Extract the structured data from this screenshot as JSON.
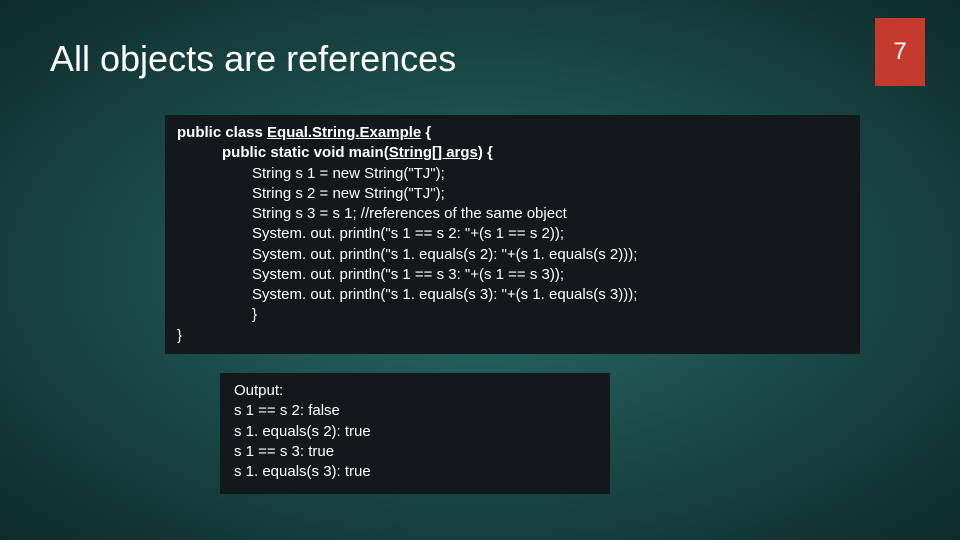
{
  "title": "All objects are references",
  "page_number": "7",
  "code": {
    "line1_pre": "public class ",
    "line1_name": "Equal.String.Example",
    "line1_post": " {",
    "line2_pre": "public static void main(",
    "line2_param": "String[] args",
    "line2_post": ") {",
    "line3": "String s 1 = new String(\"TJ\");",
    "line4": "String s 2 = new String(\"TJ\");",
    "line5": "String s 3 = s 1; //references of the same object",
    "line6": "System. out. println(\"s 1 == s 2: \"+(s 1 == s 2));",
    "line7": "System. out. println(\"s 1. equals(s 2): \"+(s 1. equals(s 2)));",
    "line8": "System. out. println(\"s 1 == s 3: \"+(s 1 == s 3));",
    "line9": "System. out. println(\"s 1. equals(s 3): \"+(s 1. equals(s 3)));",
    "line10": "}",
    "line11": "}"
  },
  "output": {
    "line1": "Output:",
    "line2": "s 1 == s 2: false",
    "line3": "s 1. equals(s 2): true",
    "line4": "s 1 == s 3: true",
    "line5": "s 1. equals(s 3): true"
  }
}
